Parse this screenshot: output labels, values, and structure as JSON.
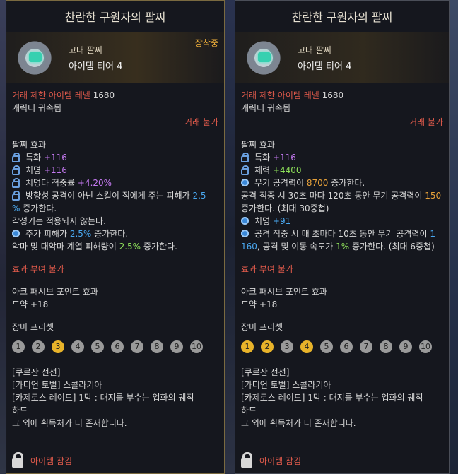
{
  "left": {
    "title": "찬란한 구원자의 팔찌",
    "grade": "고대 팔찌",
    "tier": "아이템 티어 4",
    "equipped": "장착중",
    "level_label": "거래 제한 아이템 레벨",
    "level_value": "1680",
    "bound": "캐릭터 귀속됨",
    "trade": "거래 불가",
    "effect_title": "팔찌 효과",
    "effects": [
      {
        "label": "특화",
        "value": "+116"
      },
      {
        "label": "치명",
        "value": "+116"
      },
      {
        "label": "치명타 적중률",
        "value": "+4.20%"
      }
    ],
    "effect4_a": "방향성 공격이 아닌 스킬이 적에게 주는 피해가",
    "effect4_b": "2.5",
    "effect4_c": "%",
    "effect4_d": "증가한다.",
    "awaken_note": "각성기는 적용되지 않는다.",
    "extra_a": "추가 피해가",
    "extra_b": "2.5%",
    "extra_c": "증가한다.",
    "demon_a": "악마 및 대악마 계열 피해량이",
    "demon_b": "2.5%",
    "demon_c": "증가한다.",
    "no_grant": "효과 부여 불가",
    "ark_label": "아크 패시브 포인트 효과",
    "ark_value": "도약 +18",
    "preset_label": "장비 프리셋",
    "presets": [
      "1",
      "2",
      "3",
      "4",
      "5",
      "6",
      "7",
      "8",
      "9",
      "10"
    ],
    "sources": [
      "[쿠르잔 전선]",
      "[가디언 토벌] 스콜라키아",
      "[카제로스 레이드] 1막 : 대지를 부수는 업화의 궤적 -",
      "하드",
      "그 외에 획득처가 더 존재합니다."
    ],
    "lock_label": "아이템 잠김"
  },
  "right": {
    "title": "찬란한 구원자의 팔찌",
    "grade": "고대 팔찌",
    "tier": "아이템 티어 4",
    "level_label": "거래 제한 아이템 레벨",
    "level_value": "1680",
    "bound": "캐릭터 귀속됨",
    "trade": "거래 불가",
    "effect_title": "팔찌 효과",
    "effects": [
      {
        "label": "특화",
        "value": "+116"
      },
      {
        "label": "체력",
        "value": "+4400"
      }
    ],
    "weapon_a": "무기 공격력이",
    "weapon_b": "8700",
    "weapon_c": "증가한다.",
    "hit_a": "공격 적중 시 30초 마다 120초 동안 무기 공격력이",
    "hit_b": "150",
    "hit_c": "증가한다. (최대 30중첩)",
    "crit_label": "치명",
    "crit_value": "+91",
    "tick_a": "공격 적중 시 매 초마다 10초 동안 무기 공격력이",
    "tick_b": "1",
    "tick_c": "160",
    "tick_d": ", 공격 및 이동 속도가",
    "tick_e": "1%",
    "tick_f": "증가한다. (최대 6중첩)",
    "no_grant": "효과 부여 불가",
    "ark_label": "아크 패시브 포인트 효과",
    "ark_value": "도약 +18",
    "preset_label": "장비 프리셋",
    "presets": [
      "1",
      "2",
      "3",
      "4",
      "5",
      "6",
      "7",
      "8",
      "9",
      "10"
    ],
    "sources": [
      "[쿠르잔 전선]",
      "[가디언 토벌] 스콜라키아",
      "[카제로스 레이드] 1막 : 대지를 부수는 업화의 궤적 -",
      "하드",
      "그 외에 획득처가 더 존재합니다."
    ],
    "lock_label": "아이템 잠김"
  },
  "colors": {
    "red": "#e05a4b",
    "orange": "#e8a23a",
    "purple": "#c479f0",
    "green": "#8ee05a",
    "cyan": "#4aa8f0",
    "gold": "#e8b32a"
  },
  "icons": {
    "bracelet": "bracelet-icon",
    "lock": "lock-icon",
    "effect": "effect-circle-icon"
  }
}
